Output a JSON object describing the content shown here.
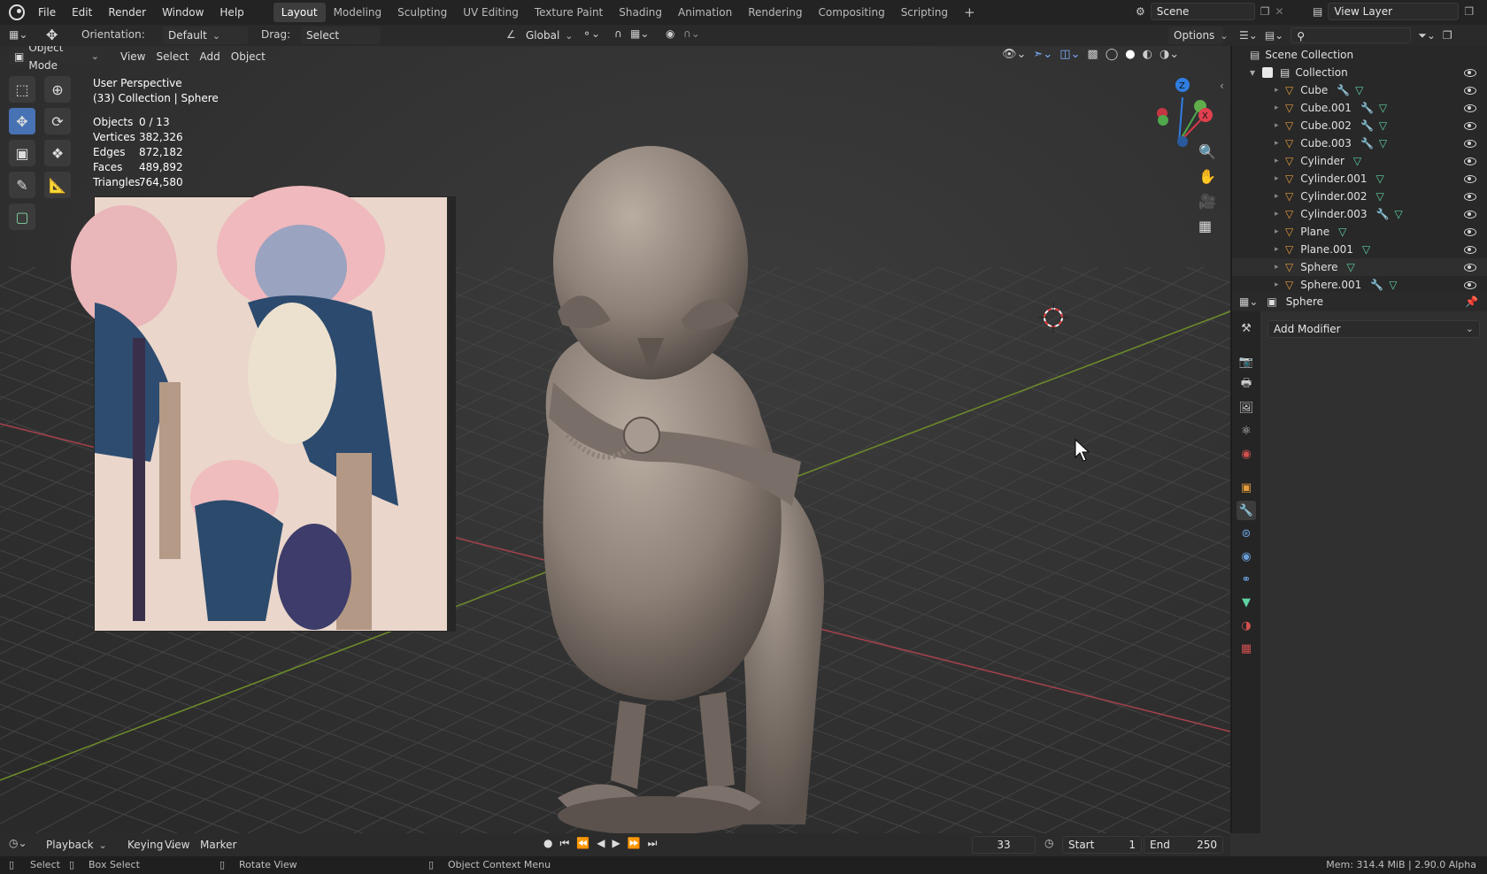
{
  "menu": {
    "file": "File",
    "edit": "Edit",
    "render": "Render",
    "window": "Window",
    "help": "Help"
  },
  "workspaces": [
    "Layout",
    "Modeling",
    "Sculpting",
    "UV Editing",
    "Texture Paint",
    "Shading",
    "Animation",
    "Rendering",
    "Compositing",
    "Scripting"
  ],
  "top_right": {
    "scene": "Scene",
    "view_layer": "View Layer"
  },
  "tool_header": {
    "orientation_label": "Orientation:",
    "orientation_value": "Default",
    "drag_label": "Drag:",
    "drag_value": "Select Box",
    "transform_value": "Global",
    "options_label": "Options"
  },
  "viewport_header": {
    "mode": "Object Mode",
    "view": "View",
    "select": "Select",
    "add": "Add",
    "object": "Object"
  },
  "overlay": {
    "perspective": "User Perspective",
    "collection": "(33) Collection | Sphere",
    "stats": [
      {
        "label": "Objects",
        "value": "0 / 13"
      },
      {
        "label": "Vertices",
        "value": "382,326"
      },
      {
        "label": "Edges",
        "value": "872,182"
      },
      {
        "label": "Faces",
        "value": "489,892"
      },
      {
        "label": "Triangles",
        "value": "764,580"
      }
    ]
  },
  "outliner": {
    "scene_collection": "Scene Collection",
    "collection": "Collection",
    "items": [
      {
        "name": "Cube",
        "modifier": true
      },
      {
        "name": "Cube.001",
        "modifier": true
      },
      {
        "name": "Cube.002",
        "modifier": true
      },
      {
        "name": "Cube.003",
        "modifier": true
      },
      {
        "name": "Cylinder",
        "modifier": false
      },
      {
        "name": "Cylinder.001",
        "modifier": false
      },
      {
        "name": "Cylinder.002",
        "modifier": false
      },
      {
        "name": "Cylinder.003",
        "modifier": true
      },
      {
        "name": "Plane",
        "modifier": false
      },
      {
        "name": "Plane.001",
        "modifier": false
      },
      {
        "name": "Sphere",
        "modifier": false
      },
      {
        "name": "Sphere.001",
        "modifier": true
      }
    ]
  },
  "properties": {
    "object_name": "Sphere",
    "add_modifier": "Add Modifier"
  },
  "timeline": {
    "playback": "Playback",
    "keying": "Keying",
    "view": "View",
    "marker": "Marker",
    "frame": "33",
    "start_label": "Start",
    "start": "1",
    "end_label": "End",
    "end": "250"
  },
  "status": {
    "select": "Select",
    "box_select": "Box Select",
    "rotate_view": "Rotate View",
    "context_menu": "Object Context Menu",
    "mem": "Mem: 314.4 MiB | 2.90.0 Alpha"
  },
  "gizmo": {
    "z": "Z",
    "y": "Y",
    "x": "X"
  },
  "colors": {
    "accent": "#4772b3",
    "mesh_orange": "#e39c3b",
    "vertex_green": "#5fd3a1",
    "modifier_blue": "#6a9ed8"
  }
}
